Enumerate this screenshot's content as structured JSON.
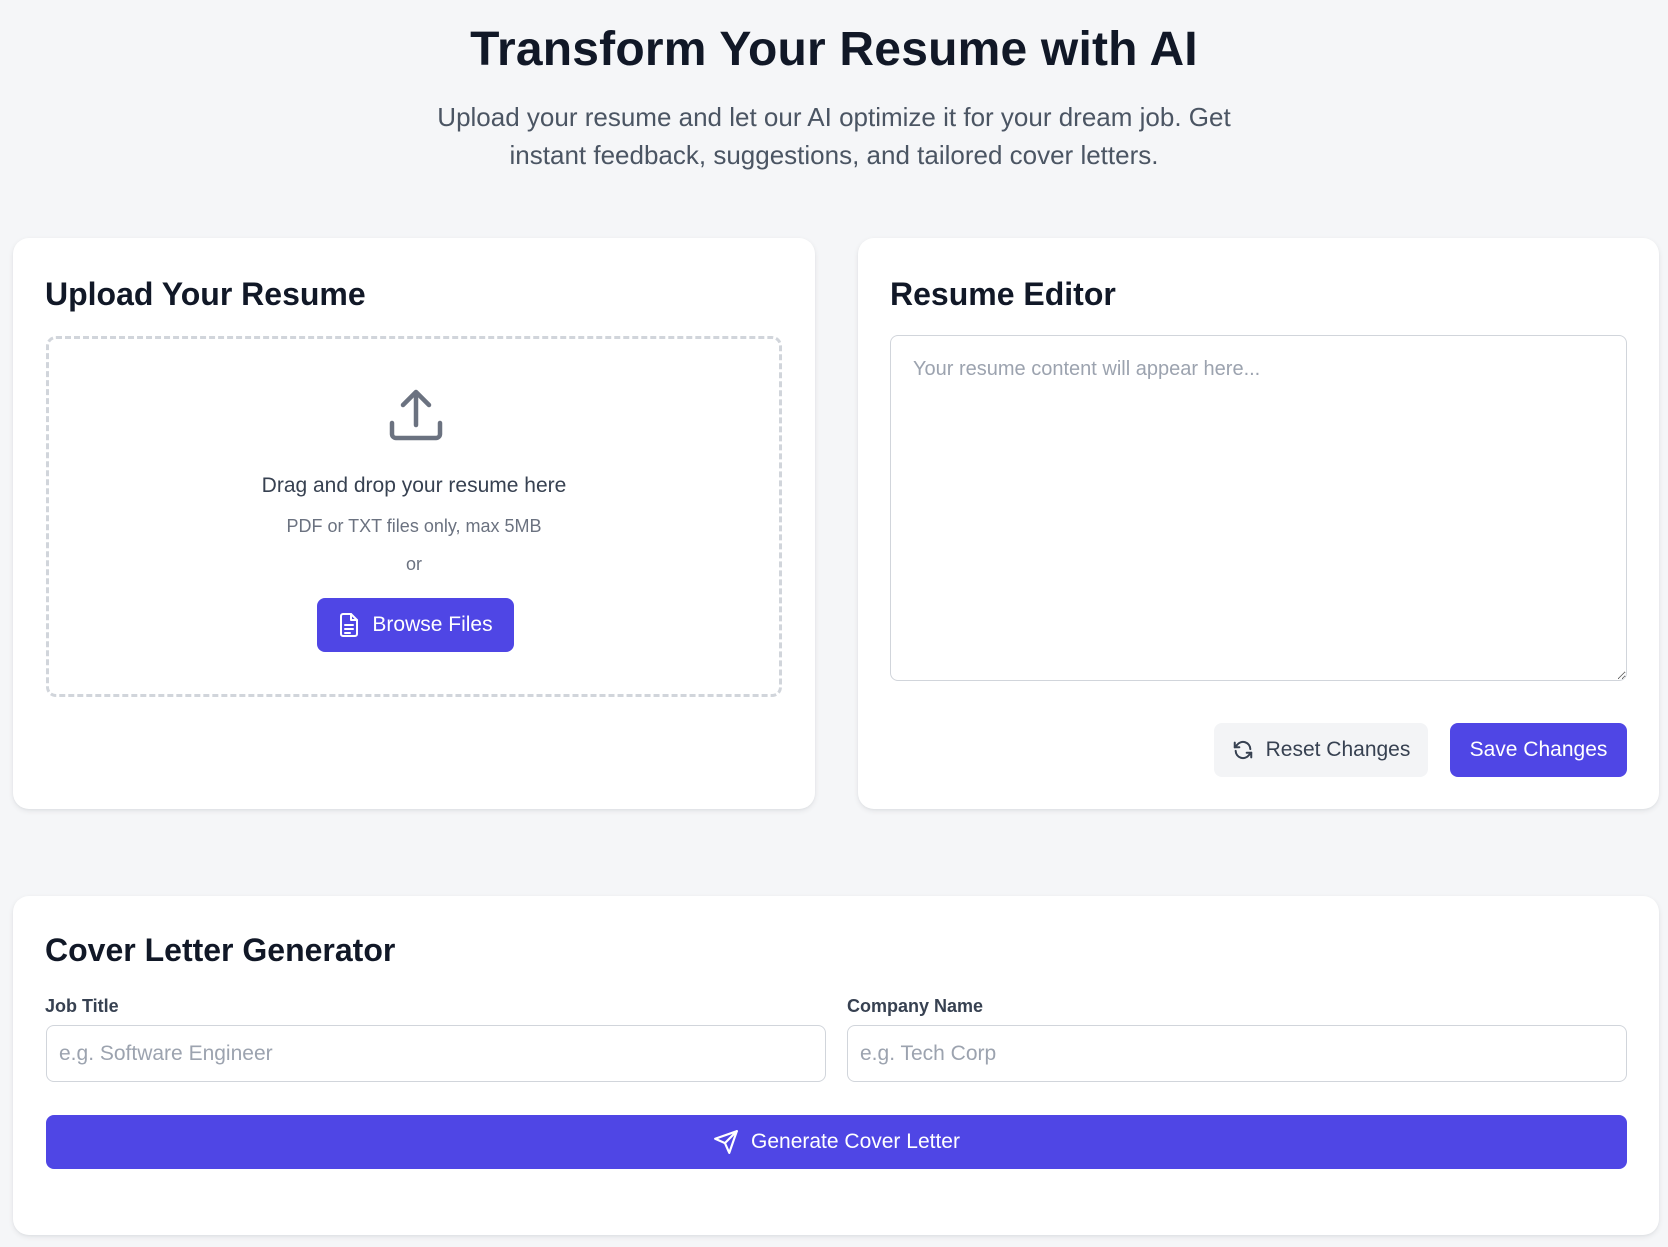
{
  "hero": {
    "title": "Transform Your Resume with AI",
    "subtitle": "Upload your resume and let our AI optimize it for your dream job. Get instant feedback, suggestions, and tailored cover letters."
  },
  "upload": {
    "title": "Upload Your Resume",
    "icon": "upload-icon",
    "drop_text": "Drag and drop your resume here",
    "hint": "PDF or TXT files only, max 5MB",
    "or_text": "or",
    "browse_label": "Browse Files",
    "browse_icon": "file-icon"
  },
  "editor": {
    "title": "Resume Editor",
    "placeholder": "Your resume content will appear here...",
    "value": "",
    "reset_label": "Reset Changes",
    "reset_icon": "refresh-icon",
    "save_label": "Save Changes"
  },
  "cover_letter": {
    "title": "Cover Letter Generator",
    "job_title_label": "Job Title",
    "job_title_placeholder": "e.g. Software Engineer",
    "job_title_value": "",
    "company_label": "Company Name",
    "company_placeholder": "e.g. Tech Corp",
    "company_value": "",
    "generate_label": "Generate Cover Letter",
    "generate_icon": "send-icon"
  },
  "colors": {
    "accent": "#4f46e5",
    "background": "#f5f6f8",
    "card": "#ffffff",
    "secondary_button": "#f3f4f6"
  }
}
